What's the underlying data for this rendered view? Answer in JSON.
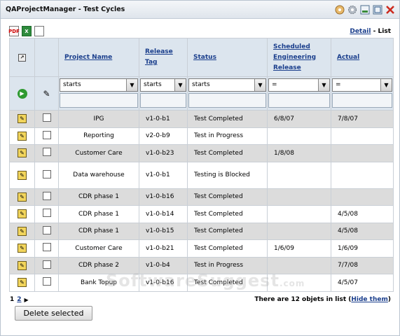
{
  "window": {
    "title": "QAProjectManager - Test Cycles"
  },
  "toolbar": {
    "pdf_icon": "PDF",
    "xls_icon": "X",
    "doc_icon": ""
  },
  "view": {
    "detail_link": "Detail",
    "separator": "-",
    "list_label": "List"
  },
  "columns": {
    "project_name": "Project Name",
    "release_tag": "Release Tag",
    "status": "Status",
    "scheduled": "Scheduled Engineering Release",
    "actual": "Actual"
  },
  "filters": {
    "project_name": "starts",
    "release_tag": "starts",
    "status": "starts",
    "scheduled": "=",
    "actual": "="
  },
  "rows": [
    {
      "project": "IPG",
      "release": "v1-0-b1",
      "status": "Test Completed",
      "scheduled": "6/8/07",
      "actual": "7/8/07"
    },
    {
      "project": "Reporting",
      "release": "v2-0-b9",
      "status": "Test in Progress",
      "scheduled": "",
      "actual": ""
    },
    {
      "project": "Customer Care",
      "release": "v1-0-b23",
      "status": "Test Completed",
      "scheduled": "1/8/08",
      "actual": ""
    },
    {
      "project": "Data warehouse",
      "release": "v1-0-b1",
      "status": "Testing is Blocked",
      "scheduled": "",
      "actual": ""
    },
    {
      "project": "CDR phase 1",
      "release": "v1-0-b16",
      "status": "Test Completed",
      "scheduled": "",
      "actual": ""
    },
    {
      "project": "CDR phase 1",
      "release": "v1-0-b14",
      "status": "Test Completed",
      "scheduled": "",
      "actual": "4/5/08"
    },
    {
      "project": "CDR phase 1",
      "release": "v1-0-b15",
      "status": "Test Completed",
      "scheduled": "",
      "actual": "4/5/08"
    },
    {
      "project": "Customer Care",
      "release": "v1-0-b21",
      "status": "Test Completed",
      "scheduled": "1/6/09",
      "actual": "1/6/09"
    },
    {
      "project": "CDR phase 2",
      "release": "v1-0-b4",
      "status": "Test in Progress",
      "scheduled": "",
      "actual": "7/7/08"
    },
    {
      "project": "Bank Topup",
      "release": "v1-0-b16",
      "status": "Test Completed",
      "scheduled": "",
      "actual": "4/5/07"
    }
  ],
  "pager": {
    "page1": "1",
    "page2": "2"
  },
  "footer": {
    "count_text": "There are 12 objets in list (",
    "hide_link": "Hide them",
    "count_close": ")"
  },
  "actions": {
    "delete_selected": "Delete selected"
  },
  "watermark": {
    "text": "SoftwareSuggest",
    "suffix": ".com"
  }
}
